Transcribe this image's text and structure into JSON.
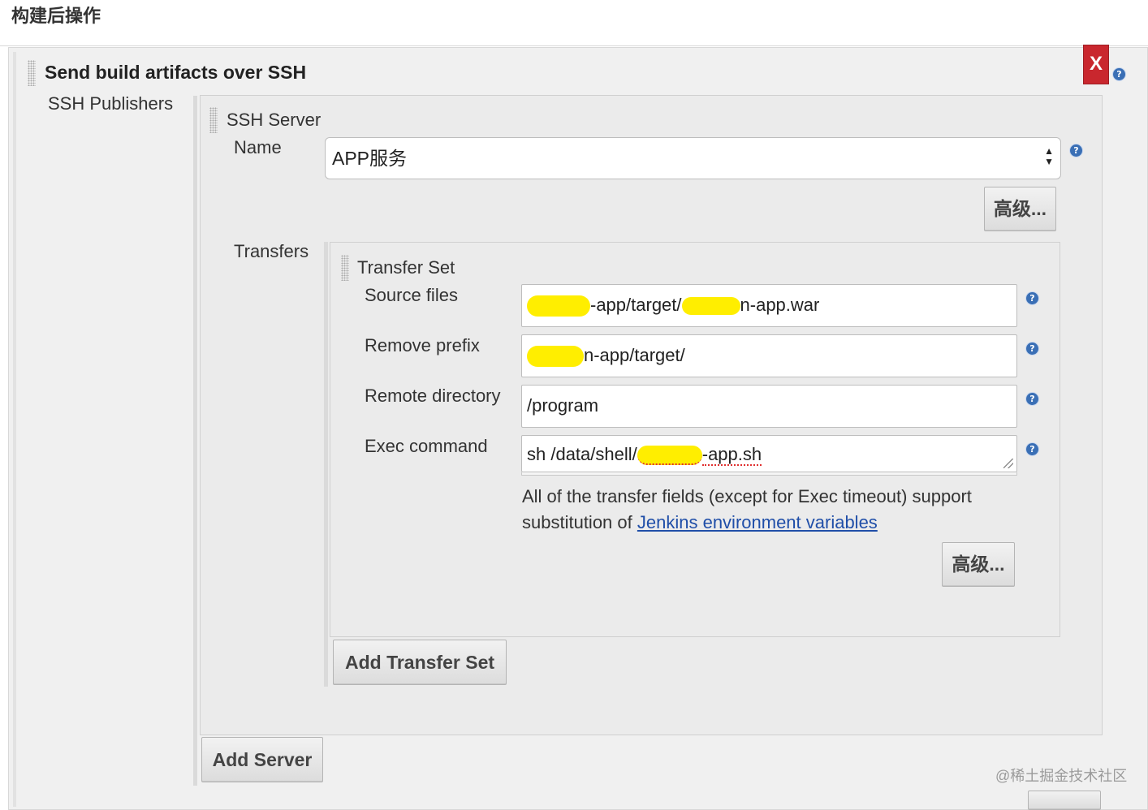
{
  "section": {
    "title": "构建后操作"
  },
  "plugin": {
    "title": "Send build artifacts over SSH",
    "delete_label": "X",
    "help_icon": "?"
  },
  "publishers": {
    "label": "SSH Publishers",
    "server_title": "SSH Server",
    "name_label": "Name",
    "name_value": "APP服务",
    "advanced_label": "高级...",
    "transfers_label": "Transfers",
    "add_server_label": "Add Server"
  },
  "transfer_set": {
    "title": "Transfer Set",
    "source_files_label": "Source files",
    "source_files_value": "-app/target/",
    "source_files_suffix": "n-app.war",
    "remove_prefix_label": "Remove prefix",
    "remove_prefix_value": "n-app/target/",
    "remote_directory_label": "Remote directory",
    "remote_directory_value": "/program",
    "exec_command_label": "Exec command",
    "exec_command_value": "sh /data/shell/",
    "exec_command_suffix": "-app.sh",
    "note_text": "All of the transfer fields (except for Exec timeout) support substitution of",
    "note_link": "Jenkins environment variables",
    "advanced_label": "高级...",
    "add_transfer_set_label": "Add Transfer Set"
  },
  "watermark": "@稀土掘金技术社区",
  "colors": {
    "delete_button": "#c9272e",
    "help_icon": "#3a6fb5",
    "link": "#1f4ea8",
    "redaction_highlight": "#ffee00"
  }
}
